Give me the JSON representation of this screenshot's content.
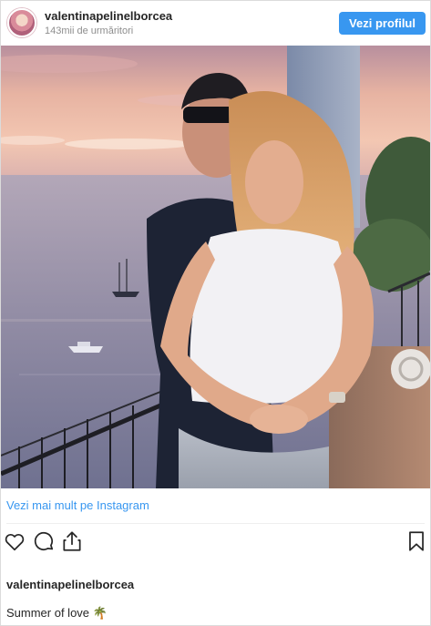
{
  "header": {
    "username": "valentinapelinelborcea",
    "followers": "143mii de urmăritori",
    "view_profile_label": "Vezi profilul"
  },
  "post": {
    "more_link": "Vezi mai mult pe Instagram",
    "caption_user": "valentinapelinelborcea",
    "caption_text": "Summer of love 🌴"
  },
  "icons": {
    "like": "heart-icon",
    "comment": "comment-icon",
    "share": "share-icon",
    "save": "bookmark-icon"
  },
  "colors": {
    "accent": "#3897f0",
    "text": "#262626",
    "muted": "#8e8e8e"
  }
}
